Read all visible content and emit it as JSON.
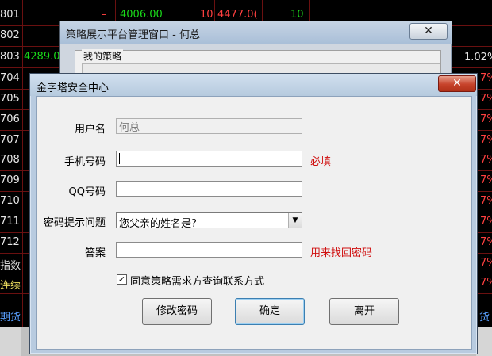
{
  "background": {
    "rows": [
      {
        "code": "801",
        "cells": [
          "",
          "–",
          "4006.00",
          "10",
          "4477.0(",
          "10"
        ]
      },
      {
        "code": "802",
        "cells": []
      },
      {
        "code": "803",
        "cells": [
          "4289.0"
        ]
      },
      {
        "code": "704",
        "cells": []
      },
      {
        "code": "705",
        "cells": []
      },
      {
        "code": "706",
        "cells": []
      },
      {
        "code": "707",
        "cells": []
      },
      {
        "code": "708",
        "cells": []
      },
      {
        "code": "709",
        "cells": []
      },
      {
        "code": "710",
        "cells": []
      },
      {
        "code": "711",
        "cells": []
      },
      {
        "code": "712",
        "cells": []
      },
      {
        "code": "指数",
        "cells": []
      },
      {
        "code": "连续",
        "cells": []
      }
    ],
    "right_value": "1.02%",
    "bottom_left": "期货",
    "bottom_right": "货"
  },
  "back_dialog": {
    "title": "策略展示平台管理窗口 - 何总",
    "close_glyph": "✕",
    "group_label": "我的策略"
  },
  "dialog": {
    "title": "金字塔安全中心",
    "close_glyph": "✕",
    "username_label": "用户名",
    "username_value": "何总",
    "phone_label": "手机号码",
    "phone_value": "",
    "phone_required": "必填",
    "qq_label": "QQ号码",
    "qq_value": "",
    "question_label": "密码提示问题",
    "question_value": "您父亲的姓名是?",
    "answer_label": "答案",
    "answer_value": "",
    "answer_hint": "用来找回密码",
    "agree_label": "同意策略需求方查询联系方式",
    "agree_checked": true,
    "buttons": {
      "change_password": "修改密码",
      "ok": "确定",
      "leave": "离开"
    }
  },
  "colors": {
    "required_red": "#d01010",
    "up_red": "#ff4040",
    "down_green": "#19d819"
  }
}
